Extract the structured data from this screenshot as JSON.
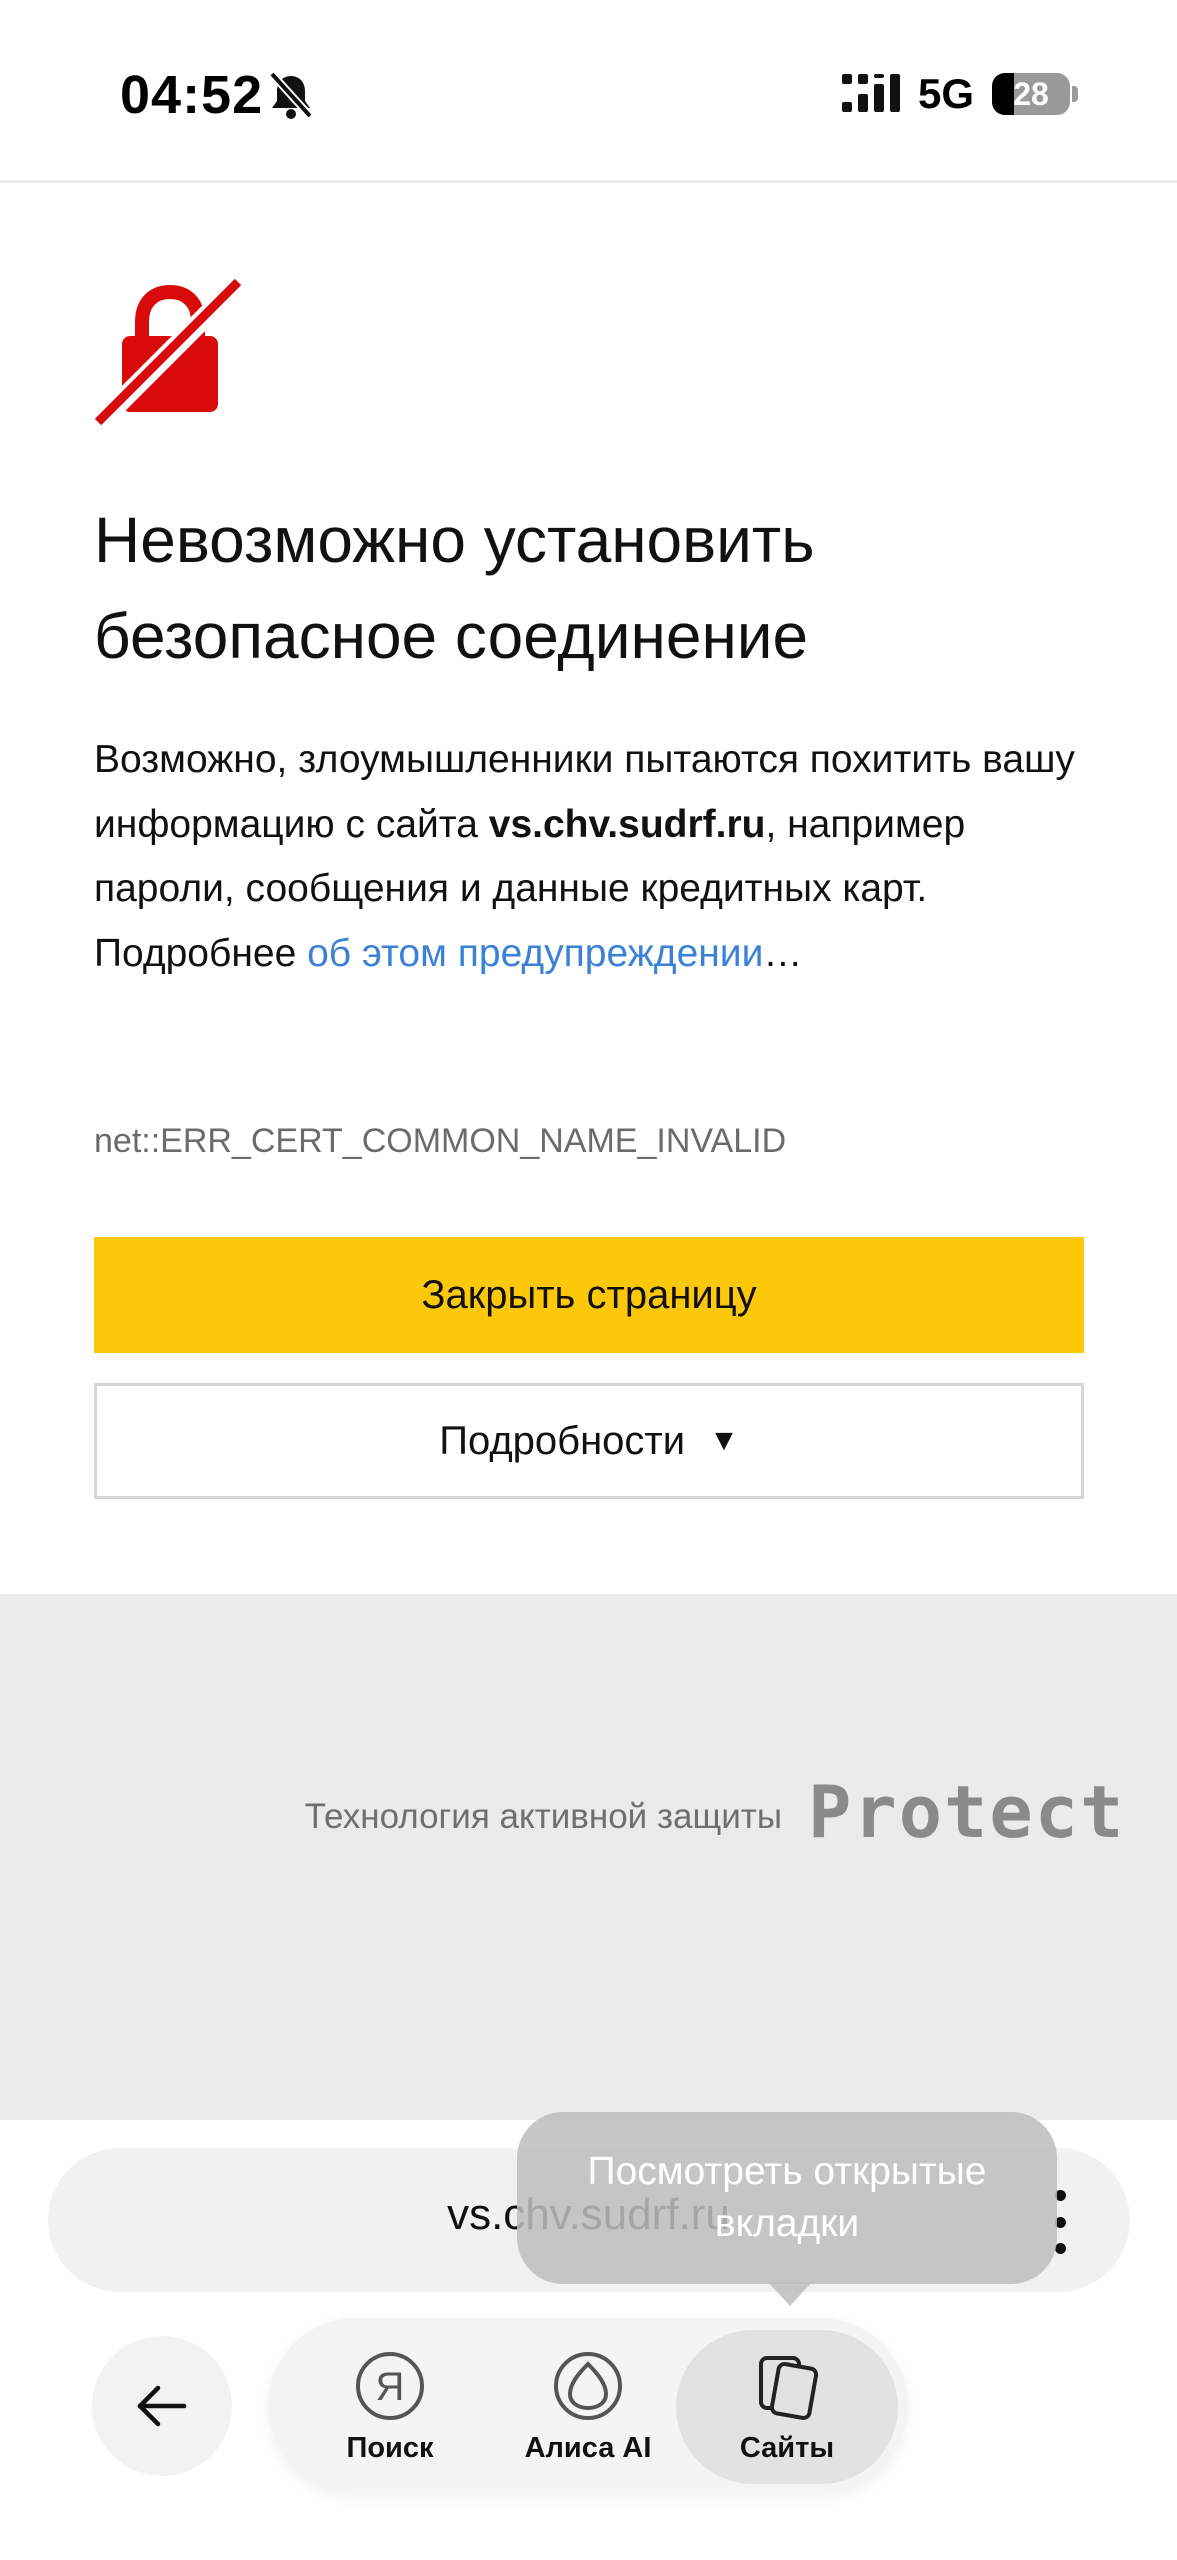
{
  "status_bar": {
    "time": "04:52",
    "network": "5G",
    "battery_level": "28",
    "battery_fraction": 0.28,
    "silent_icon": "bell-slash-icon",
    "signal_icon": "cellular-signal-icon"
  },
  "error_page": {
    "icon": "broken-lock-icon",
    "headline": "Невозможно установить безопасное соединение",
    "description_part1": "Возможно, злоумышленники пытаются похитить вашу информацию с сайта ",
    "domain": "vs.chv.sudrf.ru",
    "description_part2": ", например пароли, сообщения и данные кредитных карт. Подробнее ",
    "learn_more_link": "об этом предупреждении",
    "description_ellipsis": "…",
    "error_code": "net::ERR_CERT_COMMON_NAME_INVALID",
    "close_button": "Закрыть страницу",
    "details_button": "Подробности",
    "details_caret": "▼"
  },
  "protect": {
    "caption": "Технология активной защиты",
    "logo_text": "Protect"
  },
  "browser": {
    "url": "vs.chv.sudrf.ru",
    "tooltip": "Посмотреть открытые вкладки",
    "nav": [
      {
        "label": "Поиск",
        "icon": "yandex-search-icon"
      },
      {
        "label": "Алиса AI",
        "icon": "alice-ai-icon"
      },
      {
        "label": "Сайты",
        "icon": "tabs-icon"
      }
    ]
  },
  "colors": {
    "accent_yellow": "#fdc80a",
    "link_blue": "#3b82d6",
    "lock_red": "#d90a0a"
  }
}
